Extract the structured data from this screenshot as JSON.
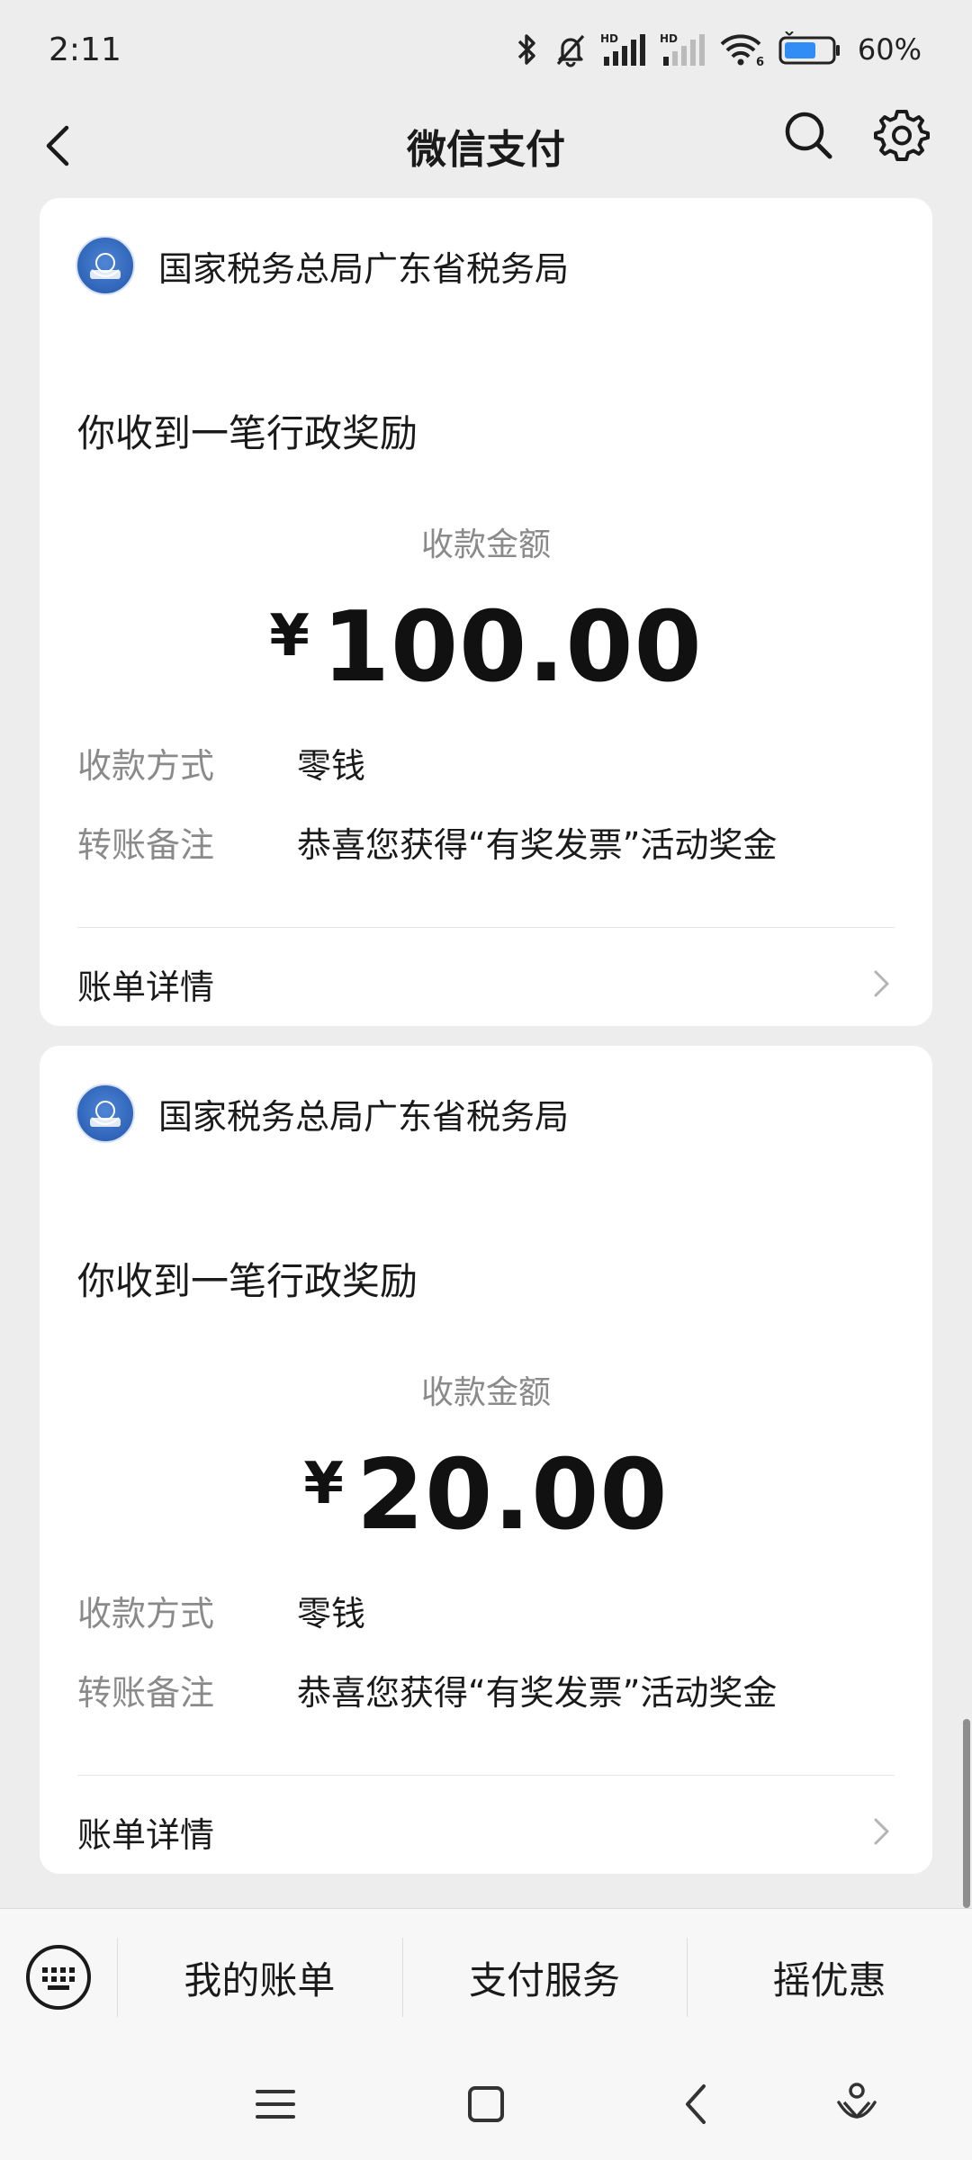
{
  "status_bar": {
    "time": "2:11",
    "battery_percent": "60%",
    "icons": [
      "bluetooth-icon",
      "mute-bell-icon",
      "hd-signal-icon",
      "hd-signal-weak-icon",
      "wifi-icon",
      "battery-icon"
    ]
  },
  "header": {
    "title": "微信支付",
    "icons": [
      "back-arrow-icon",
      "search-icon",
      "gear-icon"
    ]
  },
  "cards": [
    {
      "merchant": "国家税务总局广东省税务局",
      "notice_title": "你收到一笔行政奖励",
      "amount_label": "收款金额",
      "currency": "¥",
      "amount": "100.00",
      "method_label": "收款方式",
      "method_value": "零钱",
      "note_label": "转账备注",
      "note_value": "恭喜您获得“有奖发票”活动奖金",
      "detail_label": "账单详情"
    },
    {
      "merchant": "国家税务总局广东省税务局",
      "notice_title": "你收到一笔行政奖励",
      "amount_label": "收款金额",
      "currency": "¥",
      "amount": "20.00",
      "method_label": "收款方式",
      "method_value": "零钱",
      "note_label": "转账备注",
      "note_value": "恭喜您获得“有奖发票”活动奖金",
      "detail_label": "账单详情"
    }
  ],
  "bottom_menu": {
    "items": [
      "我的账单",
      "支付服务",
      "摇优惠"
    ],
    "keyboard_icon": "keyboard-icon"
  },
  "nav_bar": {
    "icons": [
      "menu-icon",
      "home-square-icon",
      "back-chevron-icon",
      "assistant-icon"
    ]
  },
  "colors": {
    "background": "#ededed",
    "card": "#ffffff",
    "text_primary": "#1a1a1a",
    "text_secondary": "#8a8a8a",
    "logo_blue": "#2f64b8"
  }
}
